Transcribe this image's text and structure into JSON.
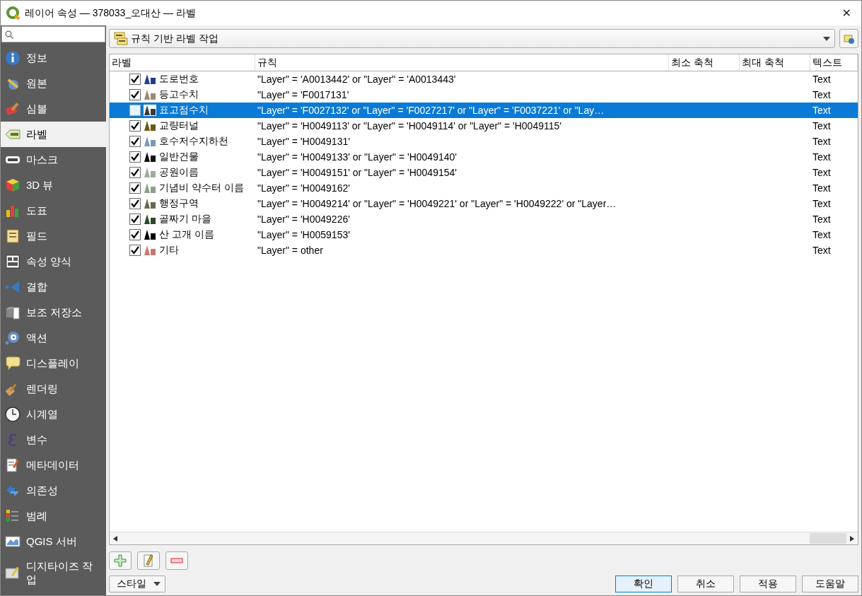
{
  "window": {
    "title": "레이어 속성 — 378033_오대산 — 라벨",
    "close": "✕"
  },
  "sidebar": {
    "items": [
      {
        "label": "정보",
        "selected": false
      },
      {
        "label": "원본",
        "selected": false
      },
      {
        "label": "심볼",
        "selected": false
      },
      {
        "label": "라벨",
        "selected": true
      },
      {
        "label": "마스크",
        "selected": false
      },
      {
        "label": "3D 뷰",
        "selected": false
      },
      {
        "label": "도표",
        "selected": false
      },
      {
        "label": "필드",
        "selected": false
      },
      {
        "label": "속성 양식",
        "selected": false
      },
      {
        "label": "결합",
        "selected": false
      },
      {
        "label": "보조 저장소",
        "selected": false
      },
      {
        "label": "액션",
        "selected": false
      },
      {
        "label": "디스플레이",
        "selected": false
      },
      {
        "label": "렌더링",
        "selected": false
      },
      {
        "label": "시계열",
        "selected": false
      },
      {
        "label": "변수",
        "selected": false
      },
      {
        "label": "메타데이터",
        "selected": false
      },
      {
        "label": "의존성",
        "selected": false
      },
      {
        "label": "범례",
        "selected": false
      },
      {
        "label": "QGIS 서버",
        "selected": false
      },
      {
        "label": "디지타이즈 작업",
        "selected": false
      }
    ]
  },
  "mode_dropdown": {
    "value": "규칙 기반 라벨 작업"
  },
  "table": {
    "columns": [
      "라벨",
      "규칙",
      "최소 축척",
      "최대 축척",
      "텍스트"
    ],
    "rows": [
      {
        "name": "도로번호",
        "rule": "\"Layer\"  = 'A0013442' or  \"Layer\"  = 'A0013443'",
        "text": "Text",
        "checked": true,
        "selected": false,
        "color": "#1f3f8f"
      },
      {
        "name": "등고수치",
        "rule": " \"Layer\"  =  'F0017131'",
        "text": "Text",
        "checked": true,
        "selected": false,
        "color": "#9a8a70"
      },
      {
        "name": "표고점수치",
        "rule": "  \"Layer\"  = 'F0027132' or  \"Layer\"  =  'F0027217' or  \"Layer\"  =  'F0037221' or  \"Lay…",
        "text": "Text",
        "checked": false,
        "selected": true,
        "color": "#3a3a3a"
      },
      {
        "name": "교량터널",
        "rule": " \"Layer\" = 'H0049113' or  \"Layer\" = 'H0049114' or  \"Layer\"  =  'H0049115'",
        "text": "Text",
        "checked": true,
        "selected": false,
        "color": "#6b5a10"
      },
      {
        "name": "호수저수지하천",
        "rule": " \"Layer\"  =  'H0049131'",
        "text": "Text",
        "checked": true,
        "selected": false,
        "color": "#7a9ab8"
      },
      {
        "name": "일반건물",
        "rule": " \"Layer\"  =  'H0049133' or  \"Layer\"  =  'H0049140'",
        "text": "Text",
        "checked": true,
        "selected": false,
        "color": "#111111"
      },
      {
        "name": "공원이름",
        "rule": " \"Layer\"  =  'H0049151' or  \"Layer\"  =  'H0049154'",
        "text": "Text",
        "checked": true,
        "selected": false,
        "color": "#9ab09a"
      },
      {
        "name": "기념비 약수터 이름",
        "rule": " \"Layer\"  =  'H0049162'",
        "text": "Text",
        "checked": true,
        "selected": false,
        "color": "#8aa08a"
      },
      {
        "name": "행정구역",
        "rule": "\"Layer\"  =  'H0049214' or  \"Layer\" = 'H0049221' or \"Layer\"  =  'H0049222' or  \"Layer…",
        "text": "Text",
        "checked": true,
        "selected": false,
        "color": "#6a6a4a"
      },
      {
        "name": "골짜기 마을",
        "rule": " \"Layer\"  =  'H0049226'",
        "text": "Text",
        "checked": true,
        "selected": false,
        "color": "#2a4a2a"
      },
      {
        "name": "산 고개 이름",
        "rule": " \"Layer\"  =  'H0059153'",
        "text": "Text",
        "checked": true,
        "selected": false,
        "color": "#000000"
      },
      {
        "name": "기타",
        "rule": " \"Layer\"  = other",
        "text": "Text",
        "checked": true,
        "selected": false,
        "color": "#c87870"
      }
    ]
  },
  "footer": {
    "style_button": "스타일",
    "buttons": [
      "확인",
      "취소",
      "적용",
      "도움말"
    ]
  }
}
